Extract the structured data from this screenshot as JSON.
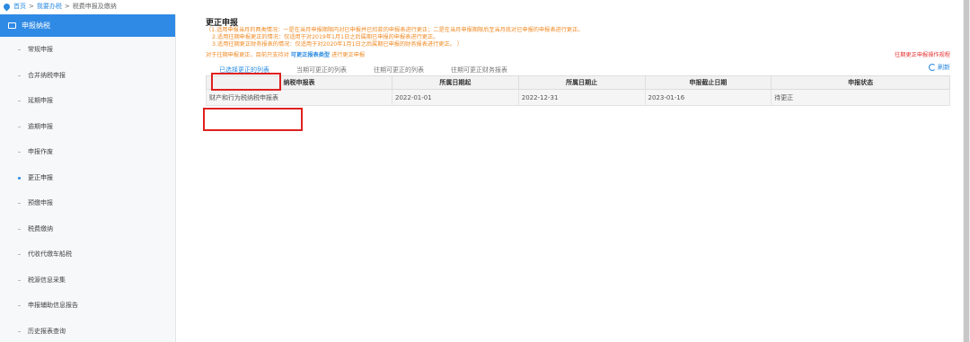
{
  "breadcrumb": [
    "首页",
    "我要办税",
    "税费申报及缴纳"
  ],
  "breadcrumb_sep": ">",
  "sidebar": {
    "header": "申报纳税",
    "items": [
      {
        "label": "常规申报"
      },
      {
        "label": "合并纳税申报"
      },
      {
        "label": "延期申报"
      },
      {
        "label": "逾期申报"
      },
      {
        "label": "申报作废"
      },
      {
        "label": "更正申报",
        "active": true
      },
      {
        "label": "预缴申报"
      },
      {
        "label": "税费缴纳"
      },
      {
        "label": "代收代缴车船税"
      },
      {
        "label": "税源信息采集"
      },
      {
        "label": "申报辅助信息报告"
      },
      {
        "label": "历史报表查询"
      }
    ]
  },
  "main": {
    "title": "更正申报",
    "notes": [
      "（1.适用申报当月的两类情况：一是在当月申报期限内对已申报并已扣款的申报表进行更正；二是在当月申报期限后至当月底对已申报的申报表进行更正。",
      "2.适用往期申报更正的情况：仅适用于对2019年1月1日之后属期已申报的申报表进行更正。",
      "3.适用往期更正财务报表的情况：仅适用于对2020年1月1日之后属期已申报的财务报表进行更正。 ）"
    ],
    "hint_prefix": "对于往期申报更正，目前只支持对",
    "hint_link": "可更正报表类型",
    "hint_suffix": "进行更正申报",
    "rules_link": "往期更正申报操作规程",
    "tabs": [
      "已选择更正的列表",
      "当期可更正的列表",
      "往期可更正的列表",
      "往期可更正财务报表"
    ],
    "refresh_label": "刷新",
    "table": {
      "headers": [
        "纳税申报表",
        "所属日期起",
        "所属日期止",
        "申报截止日期",
        "申报状态"
      ],
      "rows": [
        [
          "财产和行为税纳税申报表",
          "2022-01-01",
          "2022-12-31",
          "2023-01-16",
          "待更正"
        ]
      ]
    }
  },
  "colors": {
    "accent": "#2f8ae5",
    "note": "#f08a24",
    "highlight": "#e02020"
  }
}
